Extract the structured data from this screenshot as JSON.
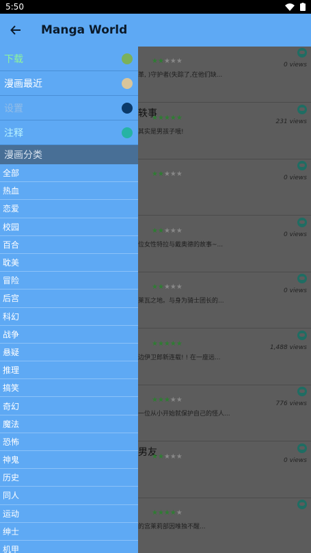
{
  "status": {
    "time": "5:50"
  },
  "appbar": {
    "title": "Manga World"
  },
  "drawer": {
    "menu": [
      {
        "label": "下载",
        "color": "#8ef59a",
        "icon": "download-icon",
        "icon_color": "#7bb15a"
      },
      {
        "label": "漫画最近",
        "color": "#ffffff",
        "icon": "clock-icon",
        "icon_color": "#d9c59a"
      },
      {
        "label": "设置",
        "color": "#93bde7",
        "icon": "gear-icon",
        "icon_color": "#0b3a6a"
      },
      {
        "label": "注释",
        "color": "#b9f3ff",
        "icon": "chat-icon",
        "icon_color": "#26b3a5"
      }
    ],
    "section_title": "漫画分类",
    "categories": [
      "全部",
      "热血",
      "恋爱",
      "校园",
      "百合",
      "耽美",
      "冒险",
      "后宫",
      "科幻",
      "战争",
      "悬疑",
      "推理",
      "搞笑",
      "奇幻",
      "魔法",
      "恐怖",
      "神鬼",
      "历史",
      "同人",
      "运动",
      "绅士",
      "机甲"
    ]
  },
  "list": [
    {
      "title": "",
      "rating": 1.5,
      "desc": "革, )守护者(失踪了,在他们缺...",
      "views": "0 views"
    },
    {
      "title": "轶事",
      "rating": 5,
      "desc": "其实是男孩子哦!",
      "views": "231 views"
    },
    {
      "title": "",
      "rating": 1.5,
      "desc": "",
      "views": "0 views"
    },
    {
      "title": "",
      "rating": 1.5,
      "desc": "位女性特拉与戴奥德的故事~...",
      "views": "0 views"
    },
    {
      "title": "",
      "rating": 1.5,
      "desc": "莱瓦之地。与身为骑士团长的...",
      "views": "0 views"
    },
    {
      "title": "",
      "rating": 4.5,
      "desc": "边伊卫郎新连载! ! 在一座远...",
      "views": "1,488 views"
    },
    {
      "title": "",
      "rating": 3,
      "desc": "一位从小开始就保护自己的怪人...",
      "views": "776 views"
    },
    {
      "title": "男友",
      "rating": 1.5,
      "desc": "",
      "views": "0 views"
    },
    {
      "title": "",
      "rating": 4,
      "desc": "的宫莱莉部因唯独不醒...",
      "views": ""
    }
  ]
}
